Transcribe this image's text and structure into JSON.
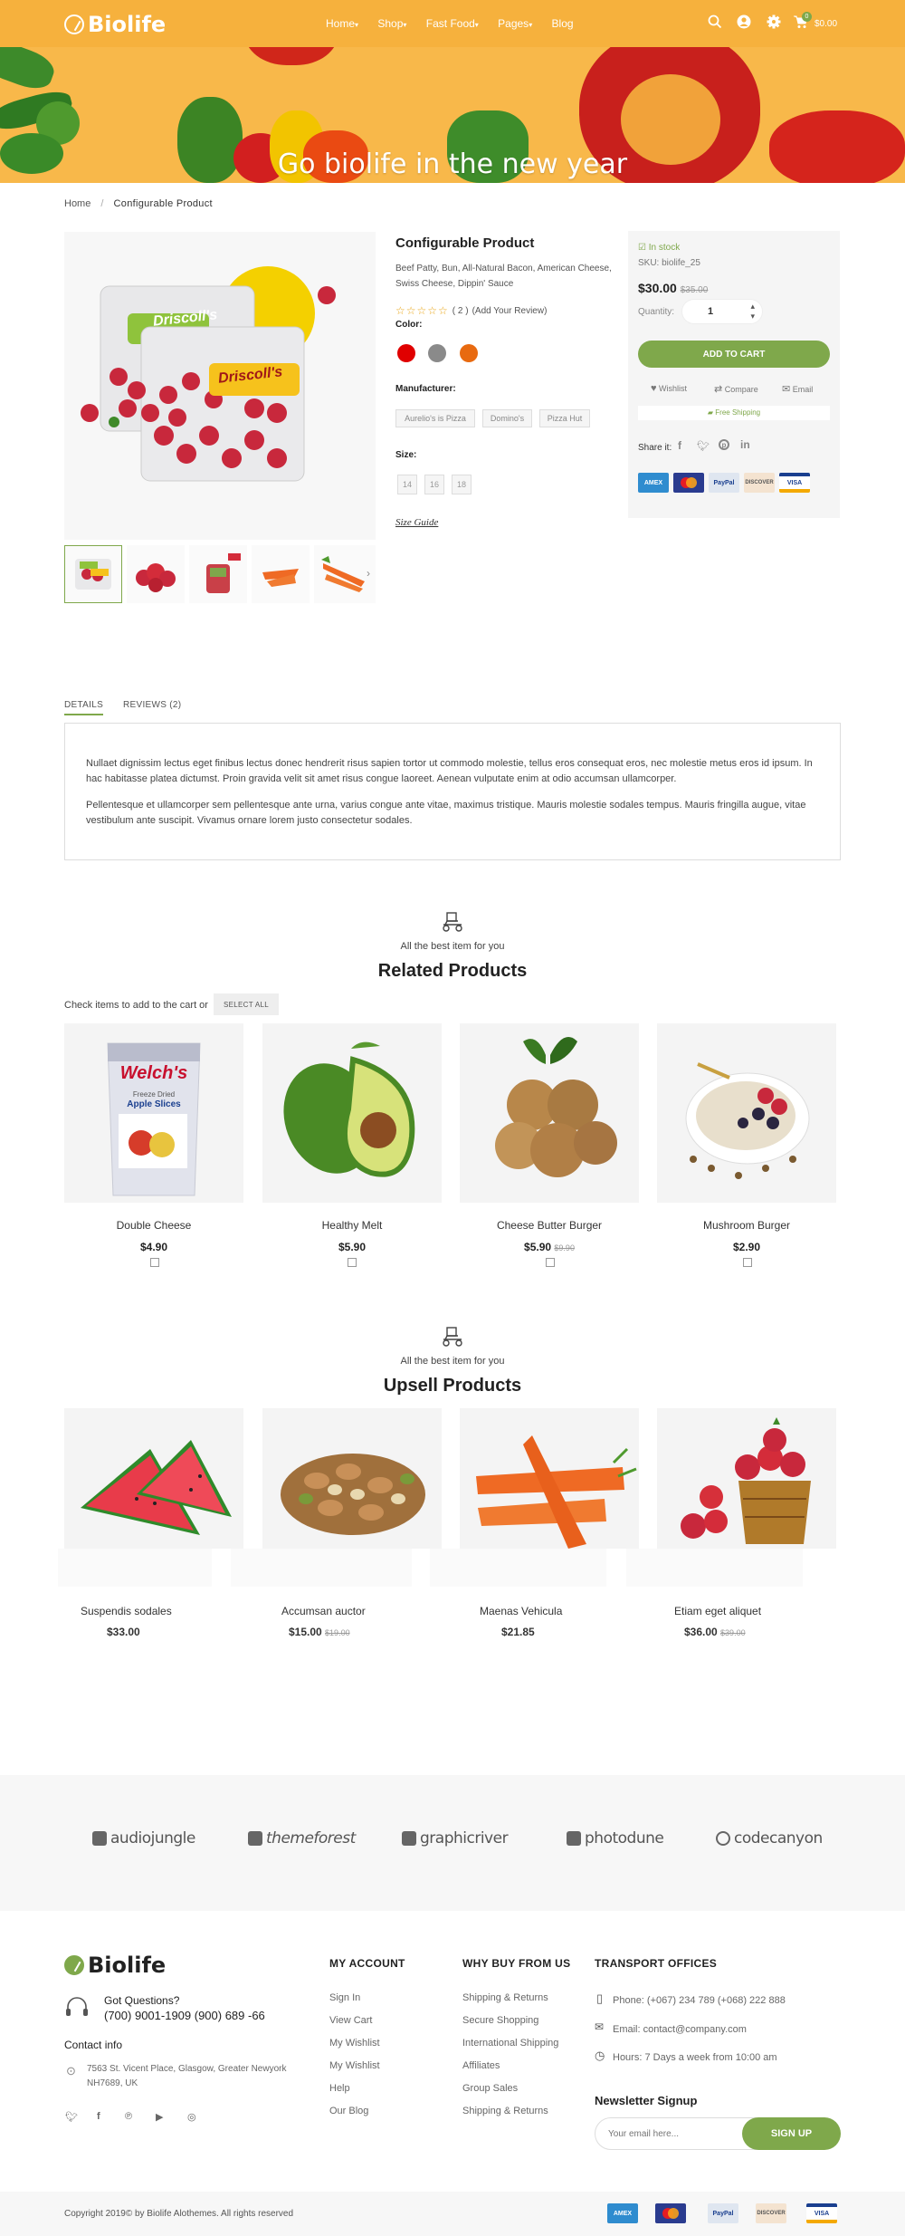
{
  "header": {
    "logo": "Biolife",
    "nav": [
      "Home",
      "Shop",
      "Fast Food",
      "Pages",
      "Blog"
    ],
    "nav_has_dropdown": [
      true,
      true,
      true,
      true,
      false
    ],
    "cart_count": "0",
    "cart_total": "$0.00",
    "icons": [
      "search-icon",
      "user-icon",
      "gear-icon",
      "cart-icon"
    ]
  },
  "banner": {
    "title": "Go biolife in the new year"
  },
  "breadcrumb": {
    "home": "Home",
    "separator": "/",
    "current": "Configurable Product"
  },
  "product": {
    "title": "Configurable Product",
    "description": "Beef Patty, Bun, All-Natural Bacon, American Cheese, Swiss Cheese, Dippin' Sauce",
    "rating_count": "( 2 )",
    "add_review": "(Add Your Review)",
    "color_label": "Color:",
    "colors": [
      "#e00000",
      "#8a8a8a",
      "#e86a10"
    ],
    "manufacturer_label": "Manufacturer:",
    "manufacturers": [
      "Aurelio's is Pizza",
      "Domino's",
      "Pizza Hut"
    ],
    "size_label": "Size:",
    "sizes": [
      "14",
      "16",
      "18"
    ],
    "size_guide": "Size Guide",
    "image_label_1": "Driscoll's",
    "image_label_2": "Driscoll's"
  },
  "buybox": {
    "stock": "In stock",
    "sku": "SKU: biolife_25",
    "price": "$30.00",
    "old_price": "$35.00",
    "quantity_label": "Quantity:",
    "quantity": "1",
    "add_to_cart": "ADD TO CART",
    "wishlist": "Wishlist",
    "compare": "Compare",
    "email": "Email",
    "free_shipping": "Free Shipping",
    "share": "Share it:",
    "payments": [
      "AMEX",
      "MasterCard",
      "PayPal",
      "DISCOVER",
      "VISA"
    ],
    "accent": "#7fa84b"
  },
  "tabs": {
    "items": [
      "DETAILS",
      "REVIEWS (2)"
    ],
    "active": "DETAILS",
    "paragraph1": "Nullaet dignissim lectus eget finibus lectus donec hendrerit risus sapien tortor ut commodo molestie, tellus eros consequat eros, nec molestie metus eros id ipsum. In hac habitasse platea dictumst. Proin gravida velit sit amet risus congue laoreet. Aenean vulputate enim at odio accumsan ullamcorper.",
    "paragraph2": "Pellentesque et ullamcorper sem pellentesque ante urna, varius congue ante vitae, maximus tristique. Mauris molestie sodales tempus. Mauris fringilla augue, vitae vestibulum ante suscipit. Vivamus ornare lorem justo consectetur sodales."
  },
  "related": {
    "subtitle": "All the best item for you",
    "title": "Related Products",
    "check_text": "Check items to add to the cart or",
    "select_all": "SELECT ALL",
    "items": [
      {
        "name": "Double Cheese",
        "price": "$4.90",
        "old": "",
        "brand": "Welch's",
        "sub": "Freeze Dried",
        "sub2": "Apple Slices"
      },
      {
        "name": "Healthy Melt",
        "price": "$5.90",
        "old": ""
      },
      {
        "name": "Cheese Butter Burger",
        "price": "$5.90",
        "old": "$9.90"
      },
      {
        "name": "Mushroom Burger",
        "price": "$2.90",
        "old": ""
      }
    ]
  },
  "upsell": {
    "subtitle": "All the best item for you",
    "title": "Upsell Products",
    "items": [
      {
        "name": "Suspendis sodales",
        "price": "$33.00",
        "old": ""
      },
      {
        "name": "Accumsan auctor",
        "price": "$15.00",
        "old": "$19.00"
      },
      {
        "name": "Maenas Vehicula",
        "price": "$21.85",
        "old": ""
      },
      {
        "name": "Etiam eget aliquet",
        "price": "$36.00",
        "old": "$39.00"
      }
    ]
  },
  "brands": [
    "audiojungle",
    "themeforest",
    "graphicriver",
    "photodune",
    "codecanyon"
  ],
  "footer": {
    "logo": "Biolife",
    "questions": "Got Questions?",
    "phone": "(700)  9001-1909 (900) 689 -66",
    "contact_title": "Contact info",
    "address": "7563 St. Vicent Place, Glasgow, Greater Newyork NH7689, UK",
    "social": [
      "twitter-icon",
      "facebook-icon",
      "pinterest-icon",
      "youtube-icon",
      "instagram-icon"
    ],
    "account_title": "MY ACCOUNT",
    "account_links": [
      "Sign In",
      "View Cart",
      "My Wishlist",
      "My Wishlist",
      "Help",
      "Our Blog"
    ],
    "why_title": "WHY BUY FROM US",
    "why_links": [
      "Shipping & Returns",
      "Secure Shopping",
      "International Shipping",
      "Affiliates",
      "Group Sales",
      "Shipping & Returns"
    ],
    "transport_title": "TRANSPORT OFFICES",
    "transport_phone": "Phone: (+067) 234 789 (+068) 222 888",
    "transport_email": "Email: contact@company.com",
    "transport_hours": "Hours: 7 Days a week from 10:00 am",
    "newsletter_title": "Newsletter Signup",
    "newsletter_placeholder": "Your email here...",
    "newsletter_button": "SIGN UP",
    "copyright": "Copyright 2019© by Biolife Alothemes. All rights reserved",
    "payments": [
      "AMEX",
      "MasterCard",
      "PayPal",
      "DISCOVER",
      "VISA"
    ]
  }
}
